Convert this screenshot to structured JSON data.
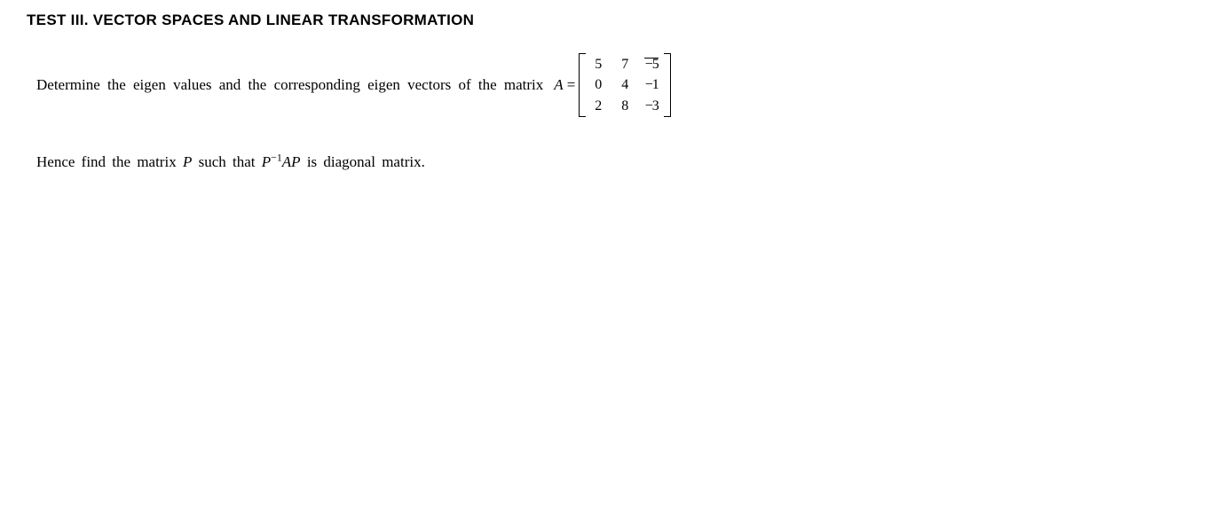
{
  "title": "TEST III. VECTOR SPACES AND LINEAR TRANSFORMATION",
  "problem": {
    "text": "Determine the eigen values and the corresponding eigen vectors of the matrix",
    "var": "A",
    "eq": "=",
    "matrix": {
      "r1c1": "5",
      "r1c2": "7",
      "r1c3": "−5",
      "r2c1": "0",
      "r2c2": "4",
      "r2c3": "−1",
      "r3c1": "2",
      "r3c2": "8",
      "r3c3": "−3"
    }
  },
  "conclusion": {
    "pre": "Hence find the matrix ",
    "P": "P",
    "mid": " such that ",
    "expr_P": "P",
    "expr_sup": "−1",
    "expr_AP": "AP",
    "post": " is diagonal matrix."
  }
}
